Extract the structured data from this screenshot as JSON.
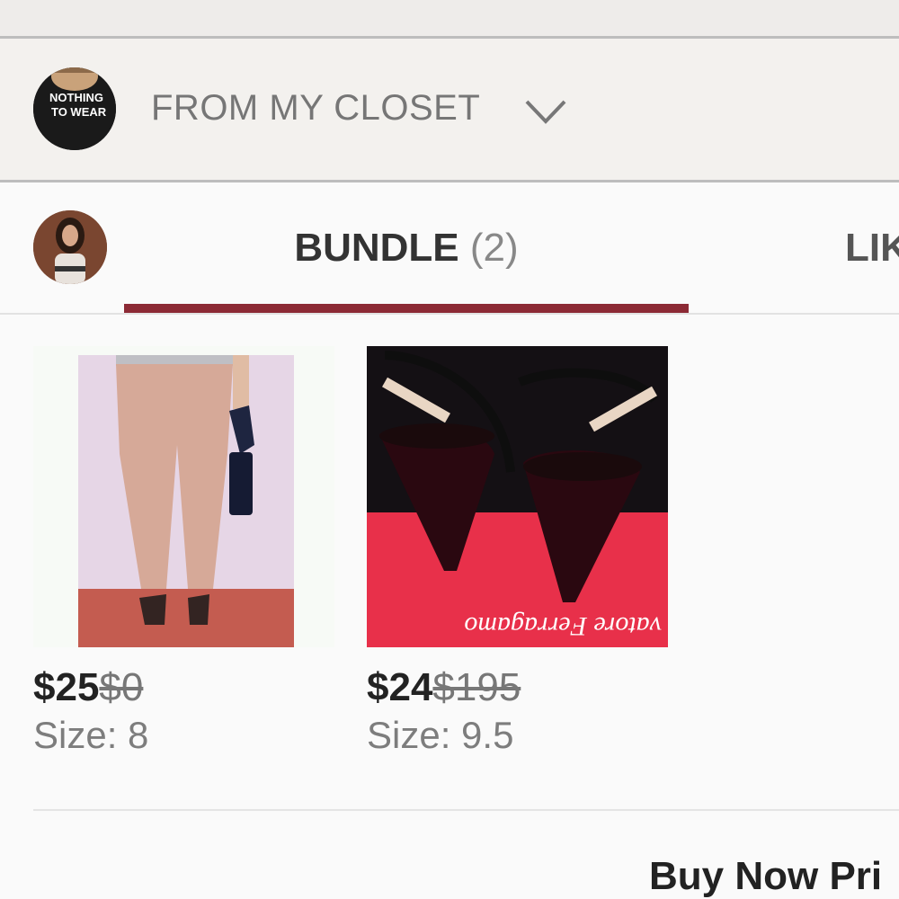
{
  "closet": {
    "title": "FROM MY CLOSET",
    "avatar_text": [
      "NOTHING",
      "TO WEAR"
    ]
  },
  "tabs": {
    "bundle_label": "BUNDLE",
    "bundle_count": "(2)",
    "likes_label": "LIK"
  },
  "items": [
    {
      "price": "$25",
      "original_price": "$0",
      "size": "Size: 8"
    },
    {
      "price": "$24",
      "original_price": "$195",
      "size": "Size: 9.5",
      "box_text": "vatore Ferragamo"
    }
  ],
  "footer": {
    "buy_now_label": "Buy Now Pri"
  },
  "colors": {
    "accent": "#8c2a35",
    "background": "#fafafa"
  }
}
